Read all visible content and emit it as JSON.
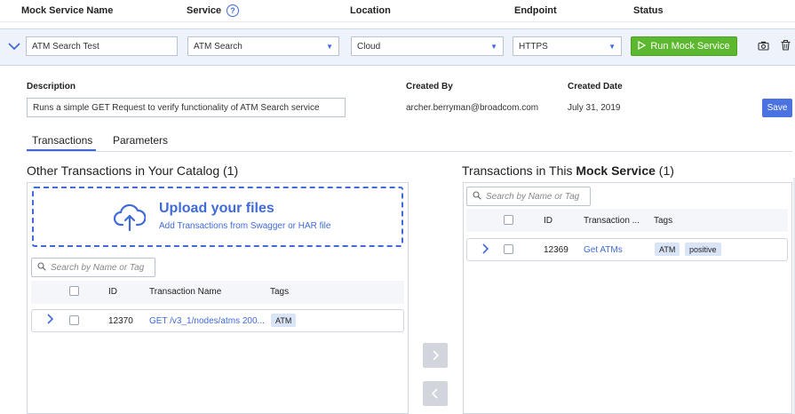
{
  "header": {
    "col_name": "Mock Service Name",
    "col_service": "Service",
    "help_icon": "?",
    "col_location": "Location",
    "col_endpoint": "Endpoint",
    "col_status": "Status"
  },
  "service_row": {
    "name_value": "ATM Search Test",
    "service_value": "ATM Search",
    "location_value": "Cloud",
    "endpoint_value": "HTTPS",
    "run_label": "Run Mock Service",
    "icons": [
      "chevron-down-icon",
      "play-icon",
      "camera-icon",
      "trash-icon"
    ]
  },
  "details": {
    "description_label": "Description",
    "description_value": "Runs a simple GET Request to verify functionality of ATM Search service",
    "created_by_label": "Created By",
    "created_by_value": "archer.berryman@broadcom.com",
    "created_date_label": "Created Date",
    "created_date_value": "July 31, 2019",
    "save_label": "Save"
  },
  "tabs": [
    {
      "label": "Transactions",
      "active": true
    },
    {
      "label": "Parameters",
      "active": false
    }
  ],
  "catalog": {
    "title": "Other Transactions in Your Catalog (1)",
    "upload_title": "Upload your files",
    "upload_subtitle": "Add Transactions from Swagger or HAR file",
    "search_placeholder": "Search by Name or Tag",
    "columns": [
      "ID",
      "Transaction Name",
      "Tags"
    ],
    "rows": [
      {
        "id": "12370",
        "name": "GET /v3_1/nodes/atms 200...",
        "tags": [
          "ATM"
        ]
      }
    ]
  },
  "mock_service": {
    "title_prefix": "Transactions in This ",
    "title_bold": "Mock Service",
    "title_suffix": " (1)",
    "search_placeholder": "Search by Name or Tag",
    "columns": [
      "ID",
      "Transaction ...",
      "Tags"
    ],
    "rows": [
      {
        "id": "12369",
        "name": "Get ATMs",
        "tags": [
          "ATM",
          "positive"
        ]
      }
    ]
  },
  "colors": {
    "accent": "#3f6ad8",
    "run_button": "#5cb82e",
    "save_button": "#4a72e0",
    "tag_bg": "#d9e4f7"
  }
}
